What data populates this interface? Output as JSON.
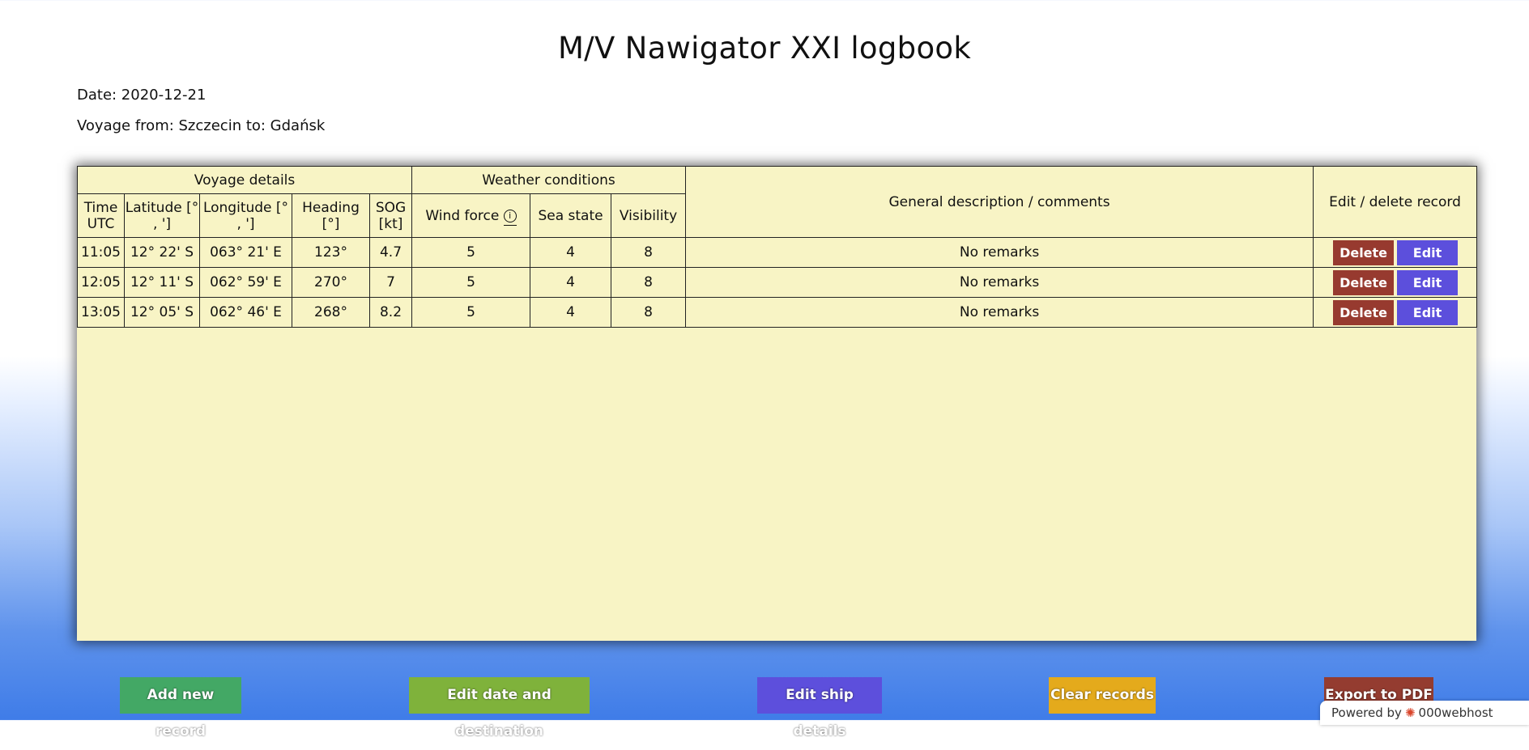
{
  "page": {
    "title": "M/V Nawigator XXI logbook",
    "date_line": "Date: 2020-12-21",
    "voyage_line": "Voyage from: Szczecin to: Gdańsk"
  },
  "table": {
    "group_headers": {
      "voyage": "Voyage details",
      "weather": "Weather conditions",
      "description": "General description / comments",
      "actions": "Edit / delete record"
    },
    "sub_headers": {
      "time": "Time UTC",
      "latitude": "Latitude [° , ']",
      "longitude": "Longitude [° , ']",
      "heading": "Heading [°]",
      "sog": "SOG [kt]",
      "wind": "Wind force",
      "sea": "Sea state",
      "visibility": "Visibility"
    },
    "rows": [
      {
        "time": "11:05",
        "lat": "12° 22' S",
        "lon": "063° 21' E",
        "heading": "123°",
        "sog": "4.7",
        "wind": "5",
        "sea": "4",
        "vis": "8",
        "remarks": "No remarks"
      },
      {
        "time": "12:05",
        "lat": "12° 11' S",
        "lon": "062° 59' E",
        "heading": "270°",
        "sog": "7",
        "wind": "5",
        "sea": "4",
        "vis": "8",
        "remarks": "No remarks"
      },
      {
        "time": "13:05",
        "lat": "12° 05' S",
        "lon": "062° 46' E",
        "heading": "268°",
        "sog": "8.2",
        "wind": "5",
        "sea": "4",
        "vis": "8",
        "remarks": "No remarks"
      }
    ],
    "delete_label": "Delete",
    "edit_label": "Edit"
  },
  "footer_buttons": {
    "add": "Add new record",
    "edit_dest": "Edit date and destination",
    "edit_ship": "Edit ship details",
    "clear": "Clear records",
    "export": "Export to PDF"
  },
  "badge": {
    "powered": "Powered by",
    "brand": "000webhost"
  },
  "colors": {
    "panel_bg": "#f8f4c5",
    "delete": "#973a2f",
    "edit": "#5c4fdc",
    "add": "#43a865",
    "edit_dest": "#7fb23b",
    "edit_ship": "#5d4fdc",
    "clear": "#e4aa1c",
    "export": "#943c30"
  }
}
